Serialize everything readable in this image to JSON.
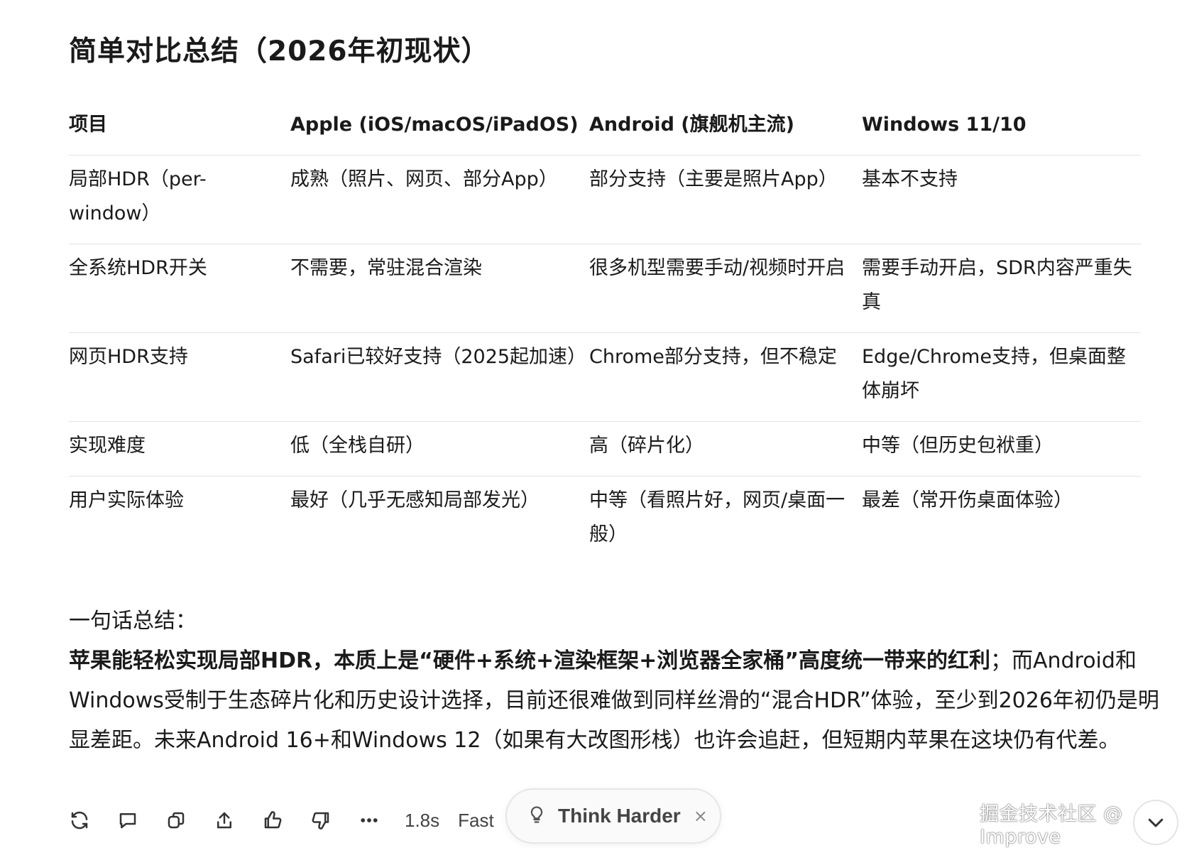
{
  "heading": "简单对比总结（2026年初现状）",
  "table": {
    "headers": [
      "项目",
      "Apple (iOS/macOS/iPadOS)",
      "Android (旗舰机主流)",
      "Windows 11/10"
    ],
    "rows": [
      [
        "局部HDR（per-window）",
        "成熟（照片、网页、部分App）",
        "部分支持（主要是照片App）",
        "基本不支持"
      ],
      [
        "全系统HDR开关",
        "不需要，常驻混合渲染",
        "很多机型需要手动/视频时开启",
        "需要手动开启，SDR内容严重失真"
      ],
      [
        "网页HDR支持",
        "Safari已较好支持（2025起加速）",
        "Chrome部分支持，但不稳定",
        "Edge/Chrome支持，但桌面整体崩坏"
      ],
      [
        "实现难度",
        "低（全栈自研）",
        "高（碎片化）",
        "中等（但历史包袱重）"
      ],
      [
        "用户实际体验",
        "最好（几乎无感知局部发光）",
        "中等（看照片好，网页/桌面一般）",
        "最差（常开伤桌面体验）"
      ]
    ]
  },
  "summary": {
    "lead": "一句话总结：",
    "bold": "苹果能轻松实现局部HDR，本质上是“硬件+系统+渲染框架+浏览器全家桶”高度统一带来的红利",
    "rest": "；而Android和Windows受制于生态碎片化和历史设计选择，目前还很难做到同样丝滑的“混合HDR”体验，至少到2026年初仍是明显差距。未来Android 16+和Windows 12（如果有大改图形栈）也许会追赶，但短期内苹果在这块仍有代差。"
  },
  "actions": {
    "icons": [
      "regenerate-icon",
      "comment-icon",
      "copy-icon",
      "share-icon",
      "thumbs-up-icon",
      "thumbs-down-icon",
      "more-icon"
    ],
    "response_time": "1.8s",
    "mode": "Fast"
  },
  "think_harder": {
    "label": "Think Harder",
    "close": "×"
  },
  "watermark": "掘金技术社区 @ Improve"
}
